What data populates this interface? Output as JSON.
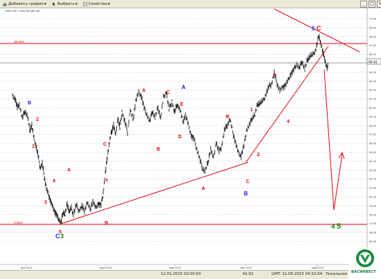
{
  "toolbar": {
    "add_chart": "Добавить график",
    "select": "Выбрать",
    "properties": "Свойства"
  },
  "chart": {
    "instrument_label": "Brent Oil 1 Hour Bid (68.43)",
    "price_tag": "68.43",
    "level_top_label": "38.20%",
    "level_bottom_label": "0.00%",
    "x_labels": [
      "янв 2015",
      "фев 2015",
      "мар 2015",
      "апр 2015",
      "май 2015"
    ],
    "y_labels": [
      "70.00",
      "69.00",
      "68.00",
      "67.00",
      "66.00",
      "65.00",
      "64.00",
      "63.00",
      "62.00",
      "61.00",
      "60.00",
      "59.00",
      "58.00",
      "57.00",
      "56.00",
      "55.00",
      "54.00",
      "53.00",
      "52.00",
      "51.00",
      "50.00",
      "49.00",
      "48.00",
      "47.00",
      "46.00",
      "45.00"
    ],
    "colors": {
      "red": "#e8000e",
      "blue": "#1a1aff",
      "green": "#0a8a0a",
      "dark_red": "#b20000",
      "grid": "#c8c8c8"
    },
    "wave_labels": [
      {
        "text": "B",
        "color": "blue"
      },
      {
        "text": "2",
        "color": "red"
      },
      {
        "text": "1",
        "color": "red"
      },
      {
        "text": "4",
        "color": "red"
      },
      {
        "text": "3",
        "color": "red"
      },
      {
        "text": "5",
        "color": "red"
      },
      {
        "text": "C",
        "color": "blue"
      },
      {
        "text": "3",
        "color": "green"
      },
      {
        "text": "A",
        "color": "red"
      },
      {
        "text": "X",
        "color": "red"
      },
      {
        "text": "B",
        "color": "red"
      },
      {
        "text": "C",
        "color": "red"
      },
      {
        "text": "A",
        "color": "red"
      },
      {
        "text": "B",
        "color": "red"
      },
      {
        "text": "C",
        "color": "red"
      },
      {
        "text": "A",
        "color": "blue"
      },
      {
        "text": "E",
        "color": "red"
      },
      {
        "text": "D",
        "color": "red"
      },
      {
        "text": "A",
        "color": "red"
      },
      {
        "text": "B",
        "color": "red"
      },
      {
        "text": "C",
        "color": "red"
      },
      {
        "text": "B",
        "color": "blue"
      },
      {
        "text": "1",
        "color": "red"
      },
      {
        "text": "2",
        "color": "red"
      },
      {
        "text": "3",
        "color": "red"
      },
      {
        "text": "4",
        "color": "red"
      },
      {
        "text": "5",
        "color": "blue"
      },
      {
        "text": "C",
        "color": "red"
      },
      {
        "text": "4",
        "color": "green"
      },
      {
        "text": "5",
        "color": "green"
      },
      {
        "text": "C",
        "color": "dark"
      }
    ]
  },
  "status": {
    "date_time": "12.01.2015 03:00:00",
    "value": "42.92",
    "gmt": "GMT: 11.05.2015 04:52:04",
    "local": "Локальное вр"
  },
  "logo": {
    "text": "ВАСИНВЕСТ"
  }
}
